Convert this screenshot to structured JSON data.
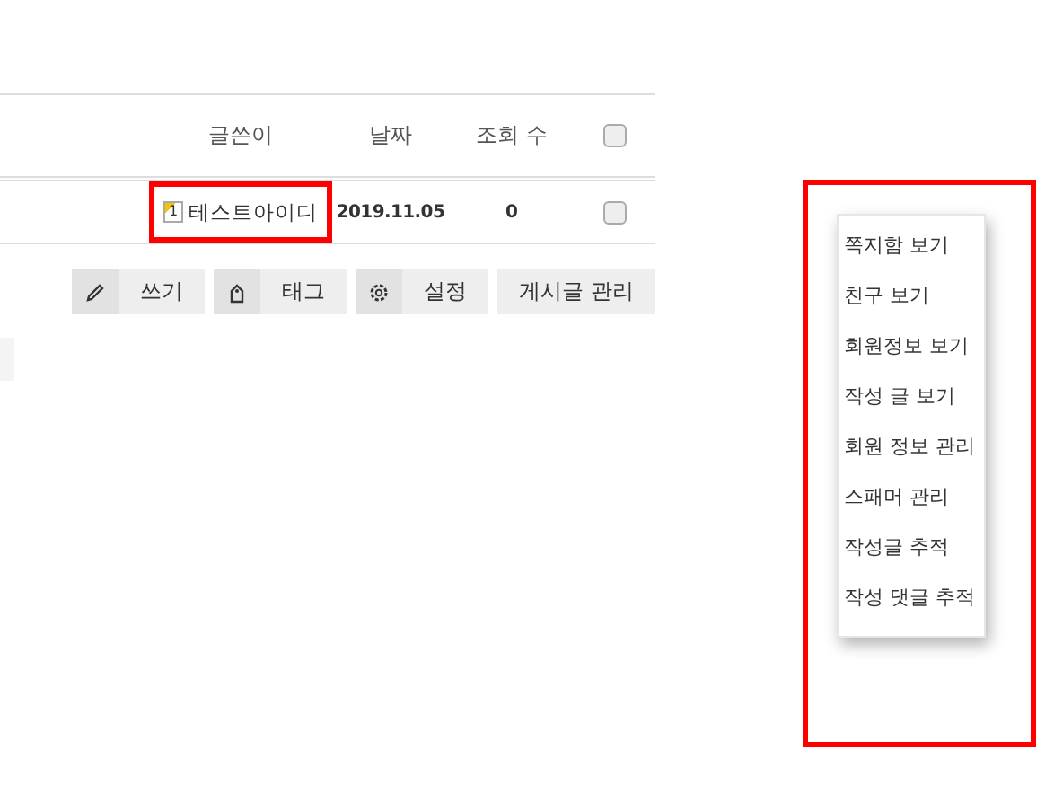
{
  "table": {
    "columns": [
      "글쓴이",
      "날짜",
      "조회 수"
    ],
    "header_checkbox": {
      "checked": false
    },
    "rows": [
      {
        "author_level": "1",
        "author": "테스트아이디",
        "author_highlighted": true,
        "date": "2019.11.05",
        "views": "0",
        "checked": false
      }
    ]
  },
  "buttons": [
    {
      "label": "쓰기",
      "kind": "pencil"
    },
    {
      "label": "태그",
      "kind": "tag"
    },
    {
      "label": "설정",
      "kind": "gear"
    },
    {
      "label": "게시글 관리",
      "kind": "plain"
    }
  ],
  "context_menu": {
    "highlighted": true,
    "items": [
      "쪽지함 보기",
      "친구 보기",
      "회원정보 보기",
      "작성 글 보기",
      "회원 정보 관리",
      "스패머 관리",
      "작성글 추적",
      "작성 댓글 추적"
    ]
  }
}
